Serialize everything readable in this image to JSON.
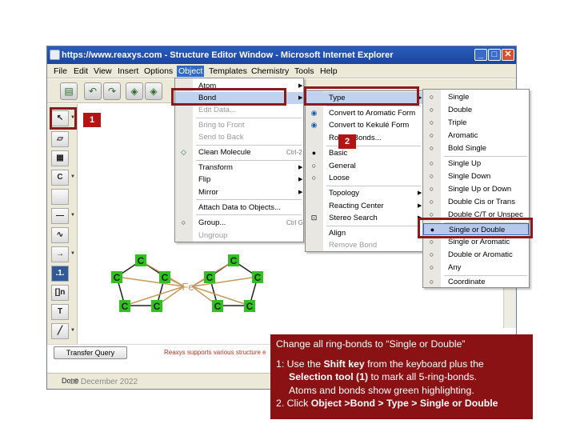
{
  "window": {
    "title": "https://www.reaxys.com - Structure Editor Window - Microsoft Internet Explorer",
    "minimize": "_",
    "maximize": "□",
    "close": "✕"
  },
  "menubar": {
    "items": [
      "File",
      "Edit",
      "View",
      "Insert",
      "Options",
      "Object",
      "Templates",
      "Chemistry",
      "Tools",
      "Help"
    ],
    "active": "Object"
  },
  "left_tools": [
    "C",
    "",
    "",
    "",
    "",
    "",
    ".1.",
    "[]n",
    "T",
    ""
  ],
  "object_menu": {
    "items": [
      {
        "label": "Atom",
        "submenu": true,
        "disabled": false
      },
      {
        "label": "Bond",
        "submenu": true,
        "disabled": false,
        "highlighted": true
      },
      {
        "label": "Edit Data...",
        "disabled": true
      },
      {
        "label": "Bring to Front",
        "disabled": true
      },
      {
        "label": "Send to Back",
        "disabled": true
      },
      {
        "label": "Clean Molecule",
        "shortcut": "Ctrl-2",
        "disabled": false
      },
      {
        "label": "Transform",
        "submenu": true,
        "disabled": false
      },
      {
        "label": "Flip",
        "submenu": true,
        "disabled": false
      },
      {
        "label": "Mirror",
        "submenu": true,
        "disabled": false
      },
      {
        "label": "Attach Data to Objects...",
        "disabled": false
      },
      {
        "label": "Group...",
        "shortcut": "Ctrl G",
        "disabled": false
      },
      {
        "label": "Ungroup",
        "disabled": true
      }
    ]
  },
  "bond_menu": {
    "items": [
      {
        "label": "Type",
        "submenu": true,
        "highlighted": true
      },
      {
        "label": "Convert to Aromatic Form"
      },
      {
        "label": "Convert to Kekulé Form"
      },
      {
        "label": "Rotate Bonds..."
      },
      {
        "label": "Basic"
      },
      {
        "label": "General"
      },
      {
        "label": "Loose"
      },
      {
        "label": "Topology",
        "submenu": true
      },
      {
        "label": "Reacting Center",
        "submenu": true
      },
      {
        "label": "Stereo Search",
        "submenu": true
      },
      {
        "label": "Align"
      },
      {
        "label": "Remove Bond",
        "disabled": true
      }
    ]
  },
  "type_menu": {
    "items": [
      "Single",
      "Double",
      "Triple",
      "Aromatic",
      "Bold Single",
      "Single Up",
      "Single Down",
      "Single Up or Down",
      "Double Cis or Trans",
      "Double C/T or Unspec",
      "Single or Double",
      "Single or Aromatic",
      "Double or Aromatic",
      "Any",
      "Coordinate"
    ],
    "selected": "Single or Double"
  },
  "canvas": {
    "center_atom": "Fe",
    "ring_atom": "C"
  },
  "bottom": {
    "transfer_button": "Transfer Query",
    "support_text": "Reaxys supports various structure e"
  },
  "status": {
    "text": "Done",
    "date": "15 December 2022"
  },
  "badges": [
    "1",
    "2"
  ],
  "callout": {
    "title": "Change all ring-bonds to “Single or Double”",
    "step1_pre": "1: Use the ",
    "step1_key": "Shift key",
    "step1_mid": " from the keyboard plus the",
    "step1_tool": "Selection tool (1)",
    "step1_post": " to mark all 5-ring-bonds.",
    "step1_line3": "Atoms and bonds show green highlighting.",
    "step2_pre": "2. Click ",
    "step2_path": "Object >Bond > Type > Single or Double"
  },
  "colors": {
    "callout_bg": "#8b1214",
    "atom_green": "#2fc21f",
    "bond_tan": "#c49a5c",
    "highlight_red": "#8b1a1a"
  }
}
